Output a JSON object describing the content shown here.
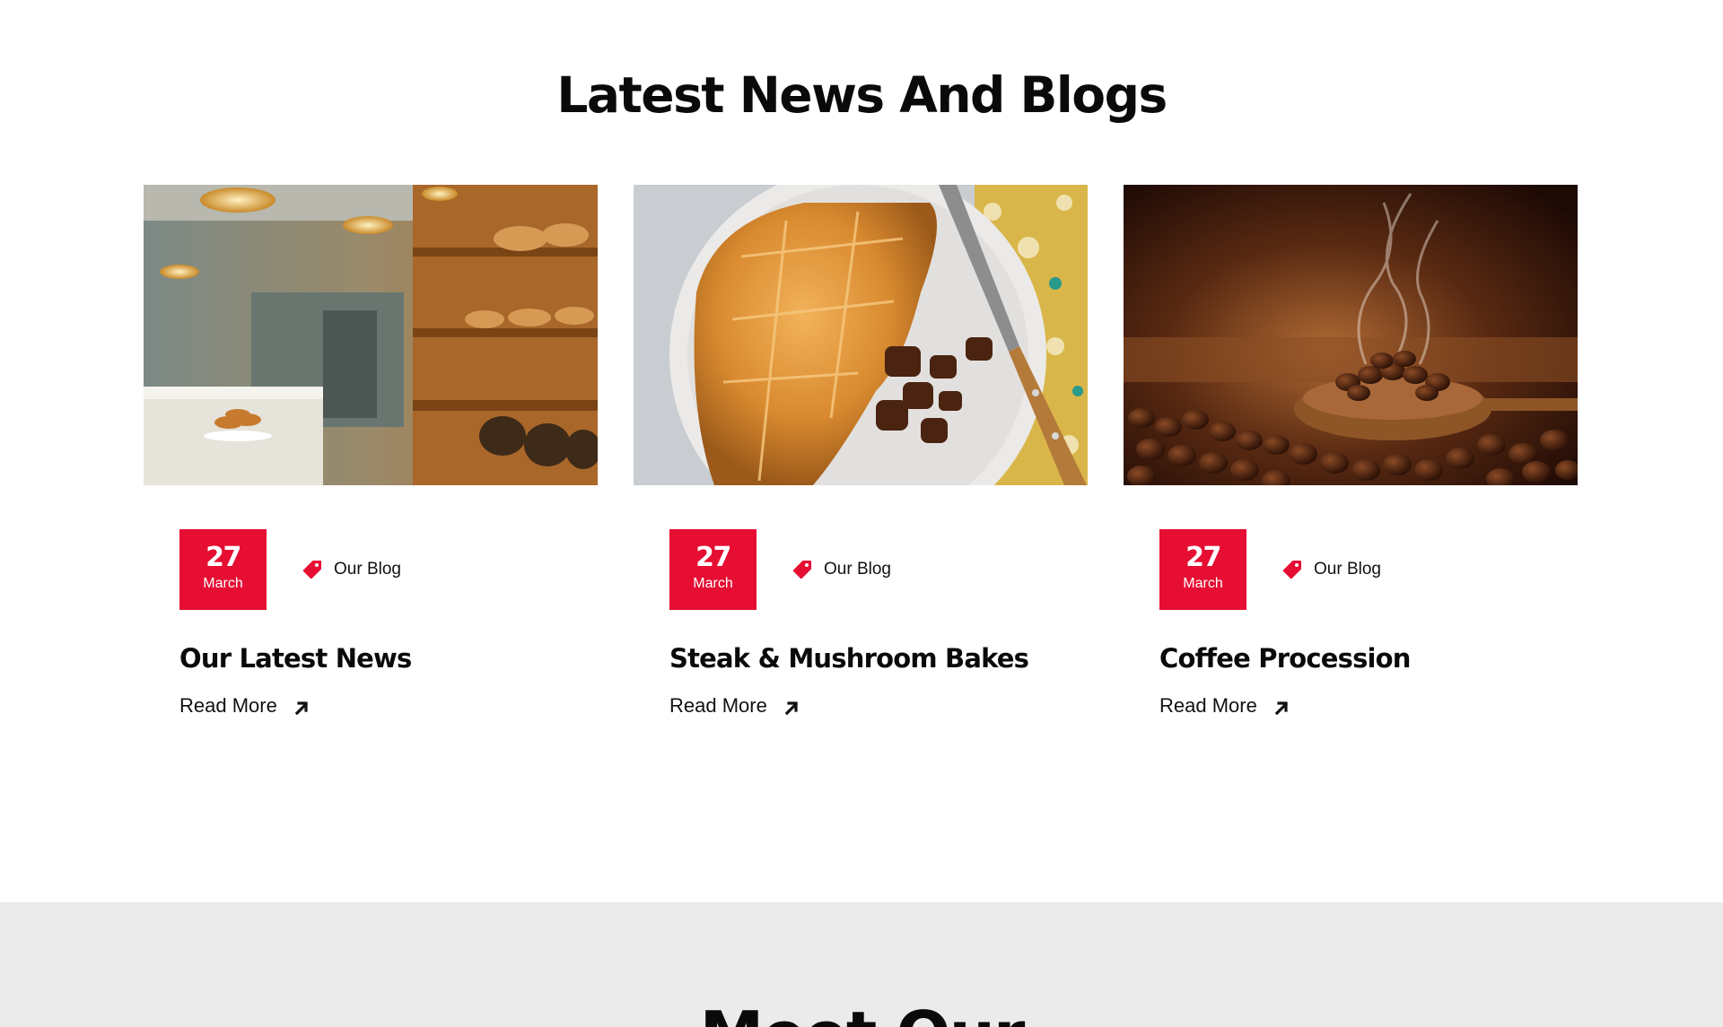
{
  "section": {
    "title": "Latest News And Blogs"
  },
  "colors": {
    "accent": "#e60e33",
    "text": "#0a0a0a",
    "next_section_background": "#ebebeb"
  },
  "posts": [
    {
      "image": "bakery-interior-photo",
      "day": "27",
      "month": "March",
      "category": "Our Blog",
      "title": "Our Latest News",
      "read_more": "Read More"
    },
    {
      "image": "steak-mushroom-pie-photo",
      "day": "27",
      "month": "March",
      "category": "Our Blog",
      "title": "Steak & Mushroom Bakes",
      "read_more": "Read More"
    },
    {
      "image": "coffee-beans-photo",
      "day": "27",
      "month": "March",
      "category": "Our Blog",
      "title": "Coffee Procession",
      "read_more": "Read More"
    }
  ],
  "next_section": {
    "title": "Meet Our"
  }
}
